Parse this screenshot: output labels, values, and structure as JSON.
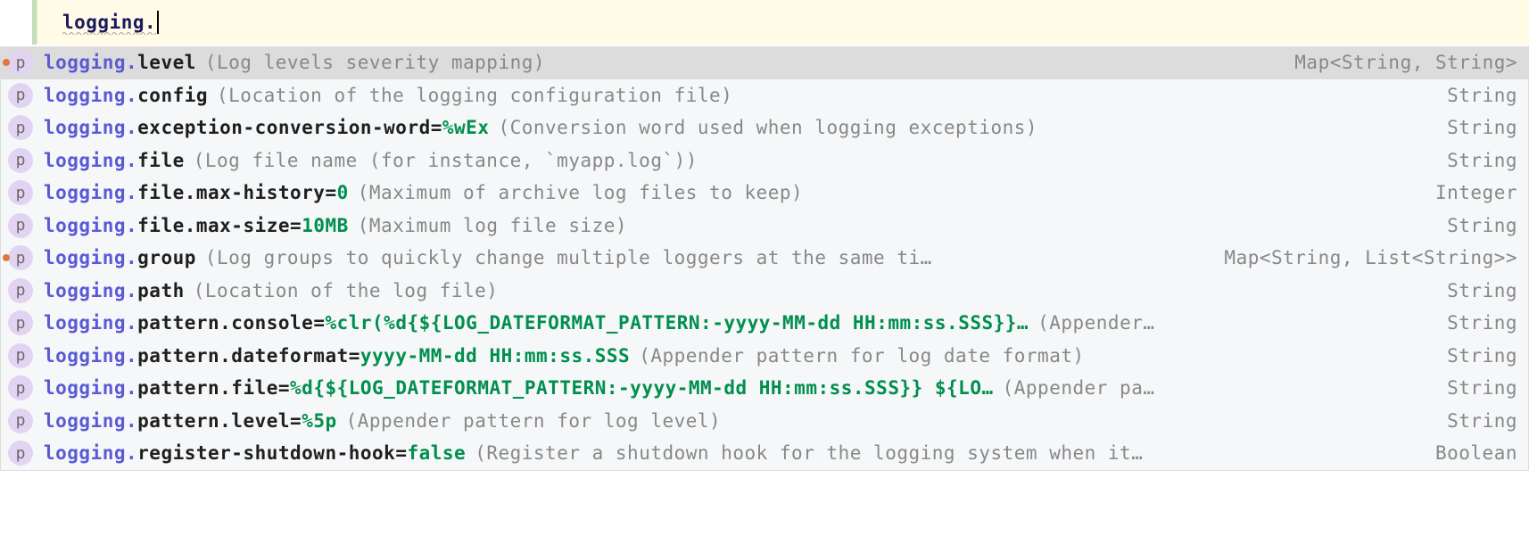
{
  "editor": {
    "typed": "logging."
  },
  "icon_letter": "p",
  "suggestions": [
    {
      "prefix": "logging.",
      "key": "level",
      "eq": "",
      "value": "",
      "desc": "(Log levels severity mapping)",
      "type": "Map<String, String>",
      "selected": true,
      "dot": true,
      "desc_trunc": false,
      "value_trunc": false
    },
    {
      "prefix": "logging.",
      "key": "config",
      "eq": "",
      "value": "",
      "desc": "(Location of the logging configuration file)",
      "type": "String",
      "selected": false,
      "dot": false,
      "desc_trunc": false,
      "value_trunc": false
    },
    {
      "prefix": "logging.",
      "key": "exception-conversion-word",
      "eq": "=",
      "value": "%wEx",
      "desc": "(Conversion word used when logging exceptions)",
      "type": "String",
      "selected": false,
      "dot": false,
      "desc_trunc": false,
      "value_trunc": false
    },
    {
      "prefix": "logging.",
      "key": "file",
      "eq": "",
      "value": "",
      "desc": "(Log file name (for instance, `myapp.log`))",
      "type": "String",
      "selected": false,
      "dot": false,
      "desc_trunc": false,
      "value_trunc": false
    },
    {
      "prefix": "logging.",
      "key": "file.max-history",
      "eq": "=",
      "value": "0",
      "desc": "(Maximum of archive log files to keep)",
      "type": "Integer",
      "selected": false,
      "dot": false,
      "desc_trunc": false,
      "value_trunc": false
    },
    {
      "prefix": "logging.",
      "key": "file.max-size",
      "eq": "=",
      "value": "10MB",
      "desc": "(Maximum log file size)",
      "type": "String",
      "selected": false,
      "dot": false,
      "desc_trunc": false,
      "value_trunc": false
    },
    {
      "prefix": "logging.",
      "key": "group",
      "eq": "",
      "value": "",
      "desc": "(Log groups to quickly change multiple loggers at the same ti…",
      "type": "Map<String, List<String>>",
      "selected": false,
      "dot": true,
      "desc_trunc": true,
      "value_trunc": false
    },
    {
      "prefix": "logging.",
      "key": "path",
      "eq": "",
      "value": "",
      "desc": "(Location of the log file)",
      "type": "String",
      "selected": false,
      "dot": false,
      "desc_trunc": false,
      "value_trunc": false
    },
    {
      "prefix": "logging.",
      "key": "pattern.console",
      "eq": "=",
      "value": "%clr(%d{${LOG_DATEFORMAT_PATTERN:-yyyy-MM-dd HH:mm:ss.SSS}}…",
      "desc": "(Appender…",
      "type": "String",
      "selected": false,
      "dot": false,
      "desc_trunc": true,
      "value_trunc": true
    },
    {
      "prefix": "logging.",
      "key": "pattern.dateformat",
      "eq": "=",
      "value": "yyyy-MM-dd HH:mm:ss.SSS",
      "desc": "(Appender pattern for log date format)",
      "type": "String",
      "selected": false,
      "dot": false,
      "desc_trunc": false,
      "value_trunc": false
    },
    {
      "prefix": "logging.",
      "key": "pattern.file",
      "eq": "=",
      "value": "%d{${LOG_DATEFORMAT_PATTERN:-yyyy-MM-dd HH:mm:ss.SSS}} ${LO…",
      "desc": "(Appender pa…",
      "type": "String",
      "selected": false,
      "dot": false,
      "desc_trunc": true,
      "value_trunc": true
    },
    {
      "prefix": "logging.",
      "key": "pattern.level",
      "eq": "=",
      "value": "%5p",
      "desc": "(Appender pattern for log level)",
      "type": "String",
      "selected": false,
      "dot": false,
      "desc_trunc": false,
      "value_trunc": false
    },
    {
      "prefix": "logging.",
      "key": "register-shutdown-hook",
      "eq": "=",
      "value": "false",
      "desc": "(Register a shutdown hook for the logging system when it…",
      "type": "Boolean",
      "selected": false,
      "dot": false,
      "desc_trunc": true,
      "value_trunc": false
    }
  ]
}
